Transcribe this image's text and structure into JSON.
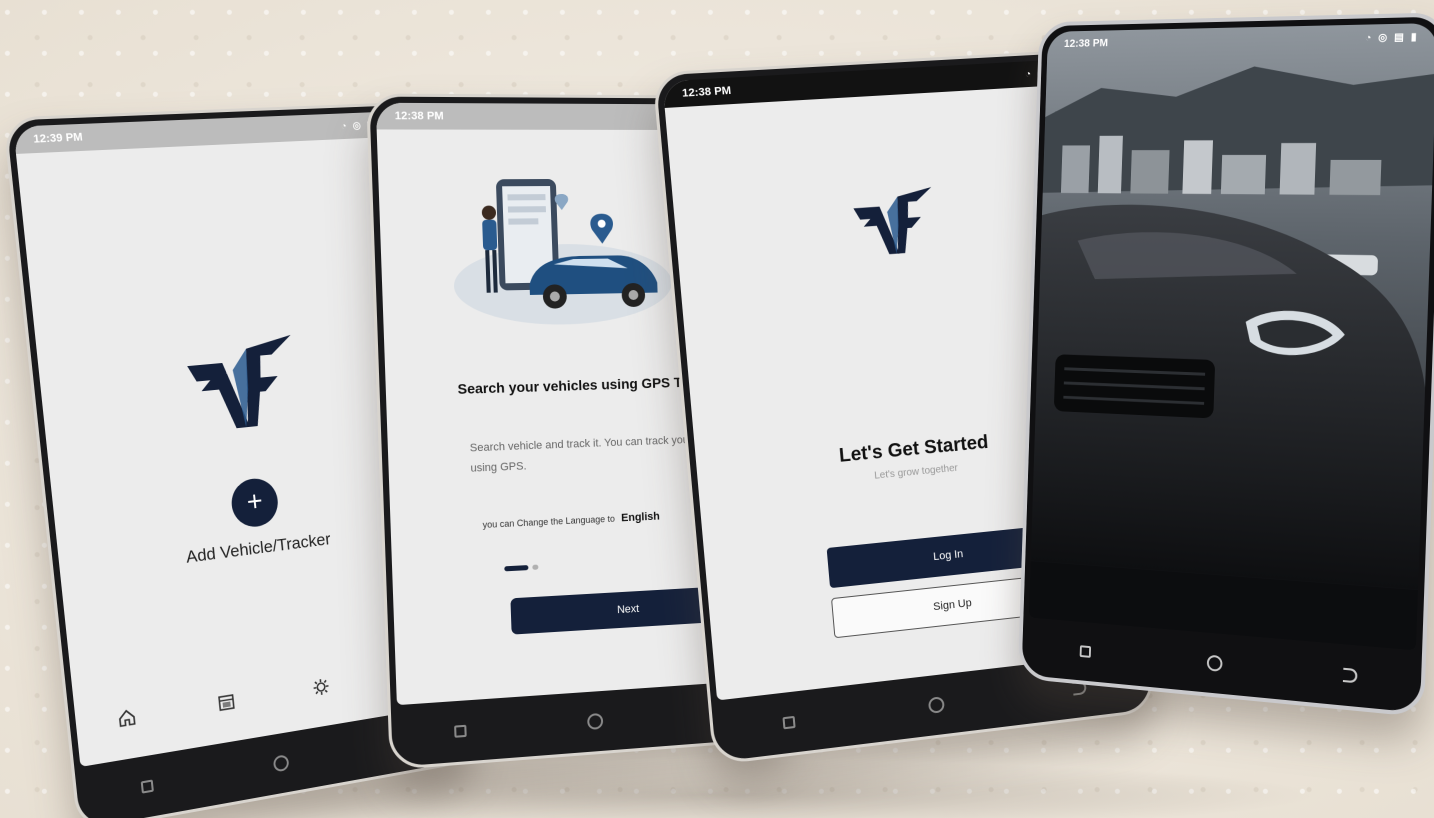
{
  "phone1": {
    "status_time": "12:39 PM",
    "status_icons": "◔ ◎ ▤ ▮",
    "add_label": "Add Vehicle/Tracker",
    "add_symbol": "+",
    "tabs": [
      "home-icon",
      "calendar-icon",
      "gear-icon",
      "user-settings-icon"
    ]
  },
  "phone2": {
    "status_time": "12:38 PM",
    "status_icons": "◔ ◎ ▤ ▮",
    "title": "Search your vehicles using GPS Tracker.",
    "description": "Search vehicle and track it. You can track your vehicle using GPS.",
    "language_prefix": "you can Change the Language to",
    "language_value": "English",
    "next_label": "Next"
  },
  "phone3": {
    "status_time": "12:38 PM",
    "status_icons": "◔ ◎ ▤ ▮",
    "title": "Let's Get Started",
    "subtitle": "Let's grow together",
    "login_label": "Log In",
    "signup_label": "Sign Up"
  },
  "phone4": {
    "status_time": "12:38 PM",
    "status_icons": "◔ ◎ ▤ ▮"
  },
  "colors": {
    "brand_navy": "#14203a",
    "brand_blue": "#2a5b8f",
    "screen_bg": "#ececec",
    "page_bg": "#efe9df"
  }
}
